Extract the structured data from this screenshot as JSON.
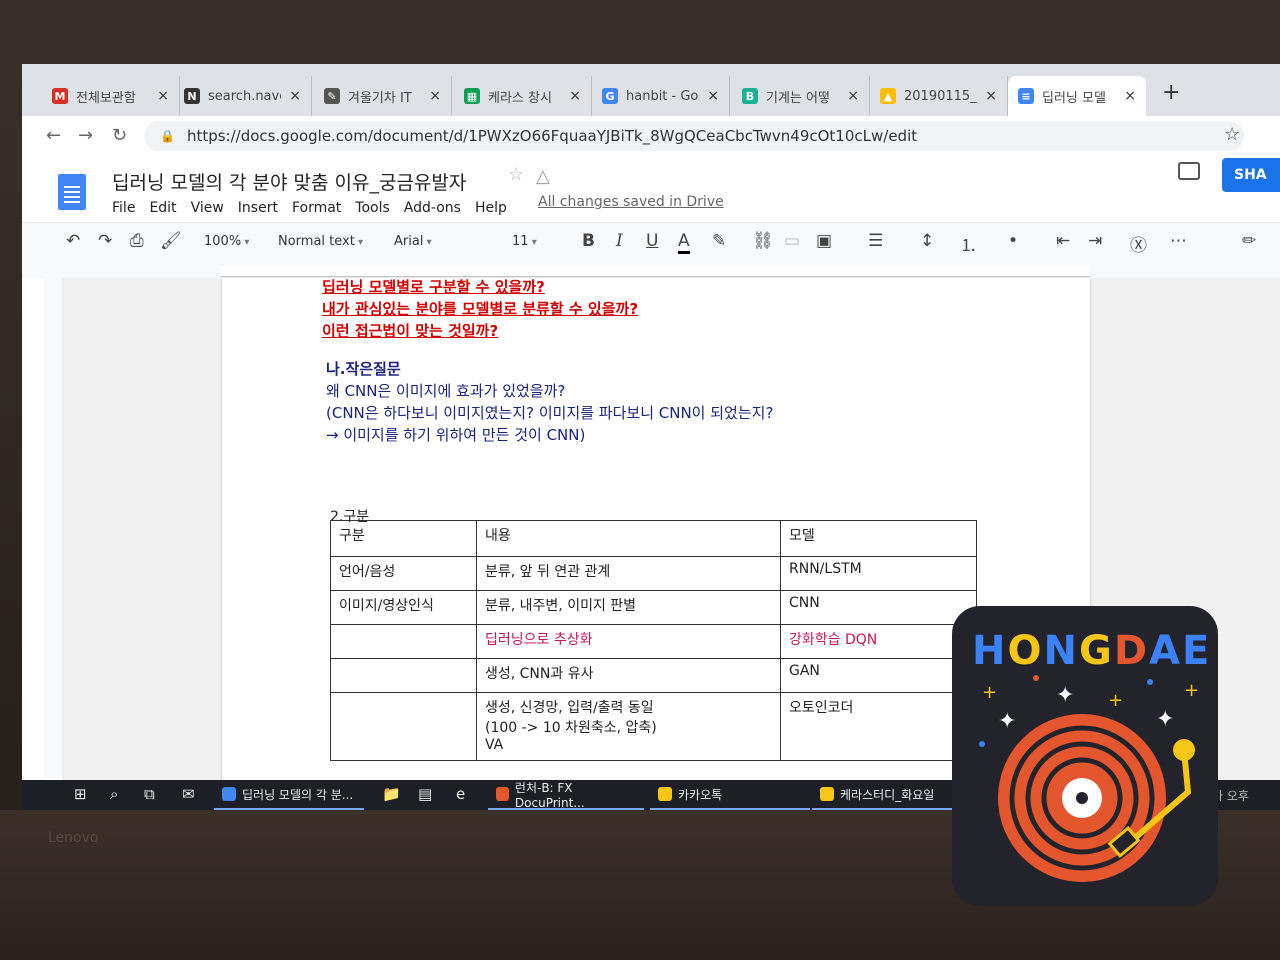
{
  "browser": {
    "tabs": [
      {
        "icon": "gmail-icon",
        "color": "#d93025",
        "glyph": "M",
        "label": "전체보관함"
      },
      {
        "icon": "notion-icon",
        "color": "#333333",
        "glyph": "N",
        "label": "search.nave"
      },
      {
        "icon": "pen-icon",
        "color": "#555555",
        "glyph": "✎",
        "label": "겨울기차 IT"
      },
      {
        "icon": "sheets-icon",
        "color": "#0f9d58",
        "glyph": "▦",
        "label": "케라스 창시"
      },
      {
        "icon": "google-icon",
        "color": "#4285f4",
        "glyph": "G",
        "label": "hanbit - Go"
      },
      {
        "icon": "app-icon",
        "color": "#19b394",
        "glyph": "B",
        "label": "기계는 어떻"
      },
      {
        "icon": "drive-icon",
        "color": "#fbbc04",
        "glyph": "▲",
        "label": "20190115_"
      },
      {
        "icon": "docs-icon",
        "color": "#4285f4",
        "glyph": "≡",
        "label": "딥러닝 모델"
      }
    ],
    "close_glyph": "×",
    "newtab_glyph": "+",
    "url": "https://docs.google.com/document/d/1PWXzO66FquaaYJBiTk_8WgQCeaCbcTwvn49cOt10cLw/edit"
  },
  "docs": {
    "title": "딥러닝 모델의 각 분야 맞춤 이유_궁금유발자",
    "menu": [
      "File",
      "Edit",
      "View",
      "Insert",
      "Format",
      "Tools",
      "Add-ons",
      "Help"
    ],
    "saved_status": "All changes saved in Drive",
    "share_label": "SHA",
    "toolbar": {
      "zoom": "100%",
      "style": "Normal text",
      "font": "Arial",
      "size": "11"
    }
  },
  "content": {
    "red_questions": [
      "딥러닝 모델별로 구분할 수 있을까?",
      "내가 관심있는 분야를 모델별로 분류할 수 있을까?",
      "이런 접근법이 맞는 것일까?"
    ],
    "small_q_heading": "나.작은질문",
    "small_q_lines": [
      "왜 CNN은 이미지에 효과가 있었을까?",
      "(CNN은 하다보니 이미지였는지? 이미지를 파다보니 CNN이 되었는지?",
      "→ 이미지를 하기 위하여 만든 것이 CNN)"
    ],
    "section_title": "2.구분",
    "table": {
      "headers": [
        "구분",
        "내용",
        "모델"
      ],
      "rows": [
        {
          "c1": "언어/음성",
          "c2": "분류, 앞 뒤 연관 관계",
          "c3": "RNN/LSTM",
          "style": "normal"
        },
        {
          "c1": "이미지/영상인식",
          "c2": "분류, 내주변, 이미지 판별",
          "c3": "CNN",
          "style": "normal"
        },
        {
          "c1": "",
          "c2": "딥러닝으로 추상화",
          "c3": "강화학습 DQN",
          "style": "magenta"
        },
        {
          "c1": "",
          "c2": "생성, CNN과 유사",
          "c3": "GAN",
          "style": "normal"
        },
        {
          "c1": "",
          "c2": "생성, 신경망, 입력/출력 동일\n(100 -> 10 차원축소, 압축)\nVA",
          "c3": "오토인코더",
          "style": "normal"
        }
      ]
    }
  },
  "taskbar": {
    "apps": [
      {
        "label": "딥러닝 모델의 각 분...",
        "color": "#4285f4"
      },
      {
        "label": "런처-B: FX DocuPrint...",
        "color": "#e4572e"
      },
      {
        "label": "카카오톡",
        "color": "#f5c518"
      },
      {
        "label": "케라스터디_화요일",
        "color": "#f5c518"
      }
    ],
    "tray": "가   오후"
  },
  "sticker": {
    "word": [
      "H",
      "O",
      "N",
      "G",
      "D",
      "A",
      "E"
    ]
  },
  "laptop_brand": "Lenovo"
}
